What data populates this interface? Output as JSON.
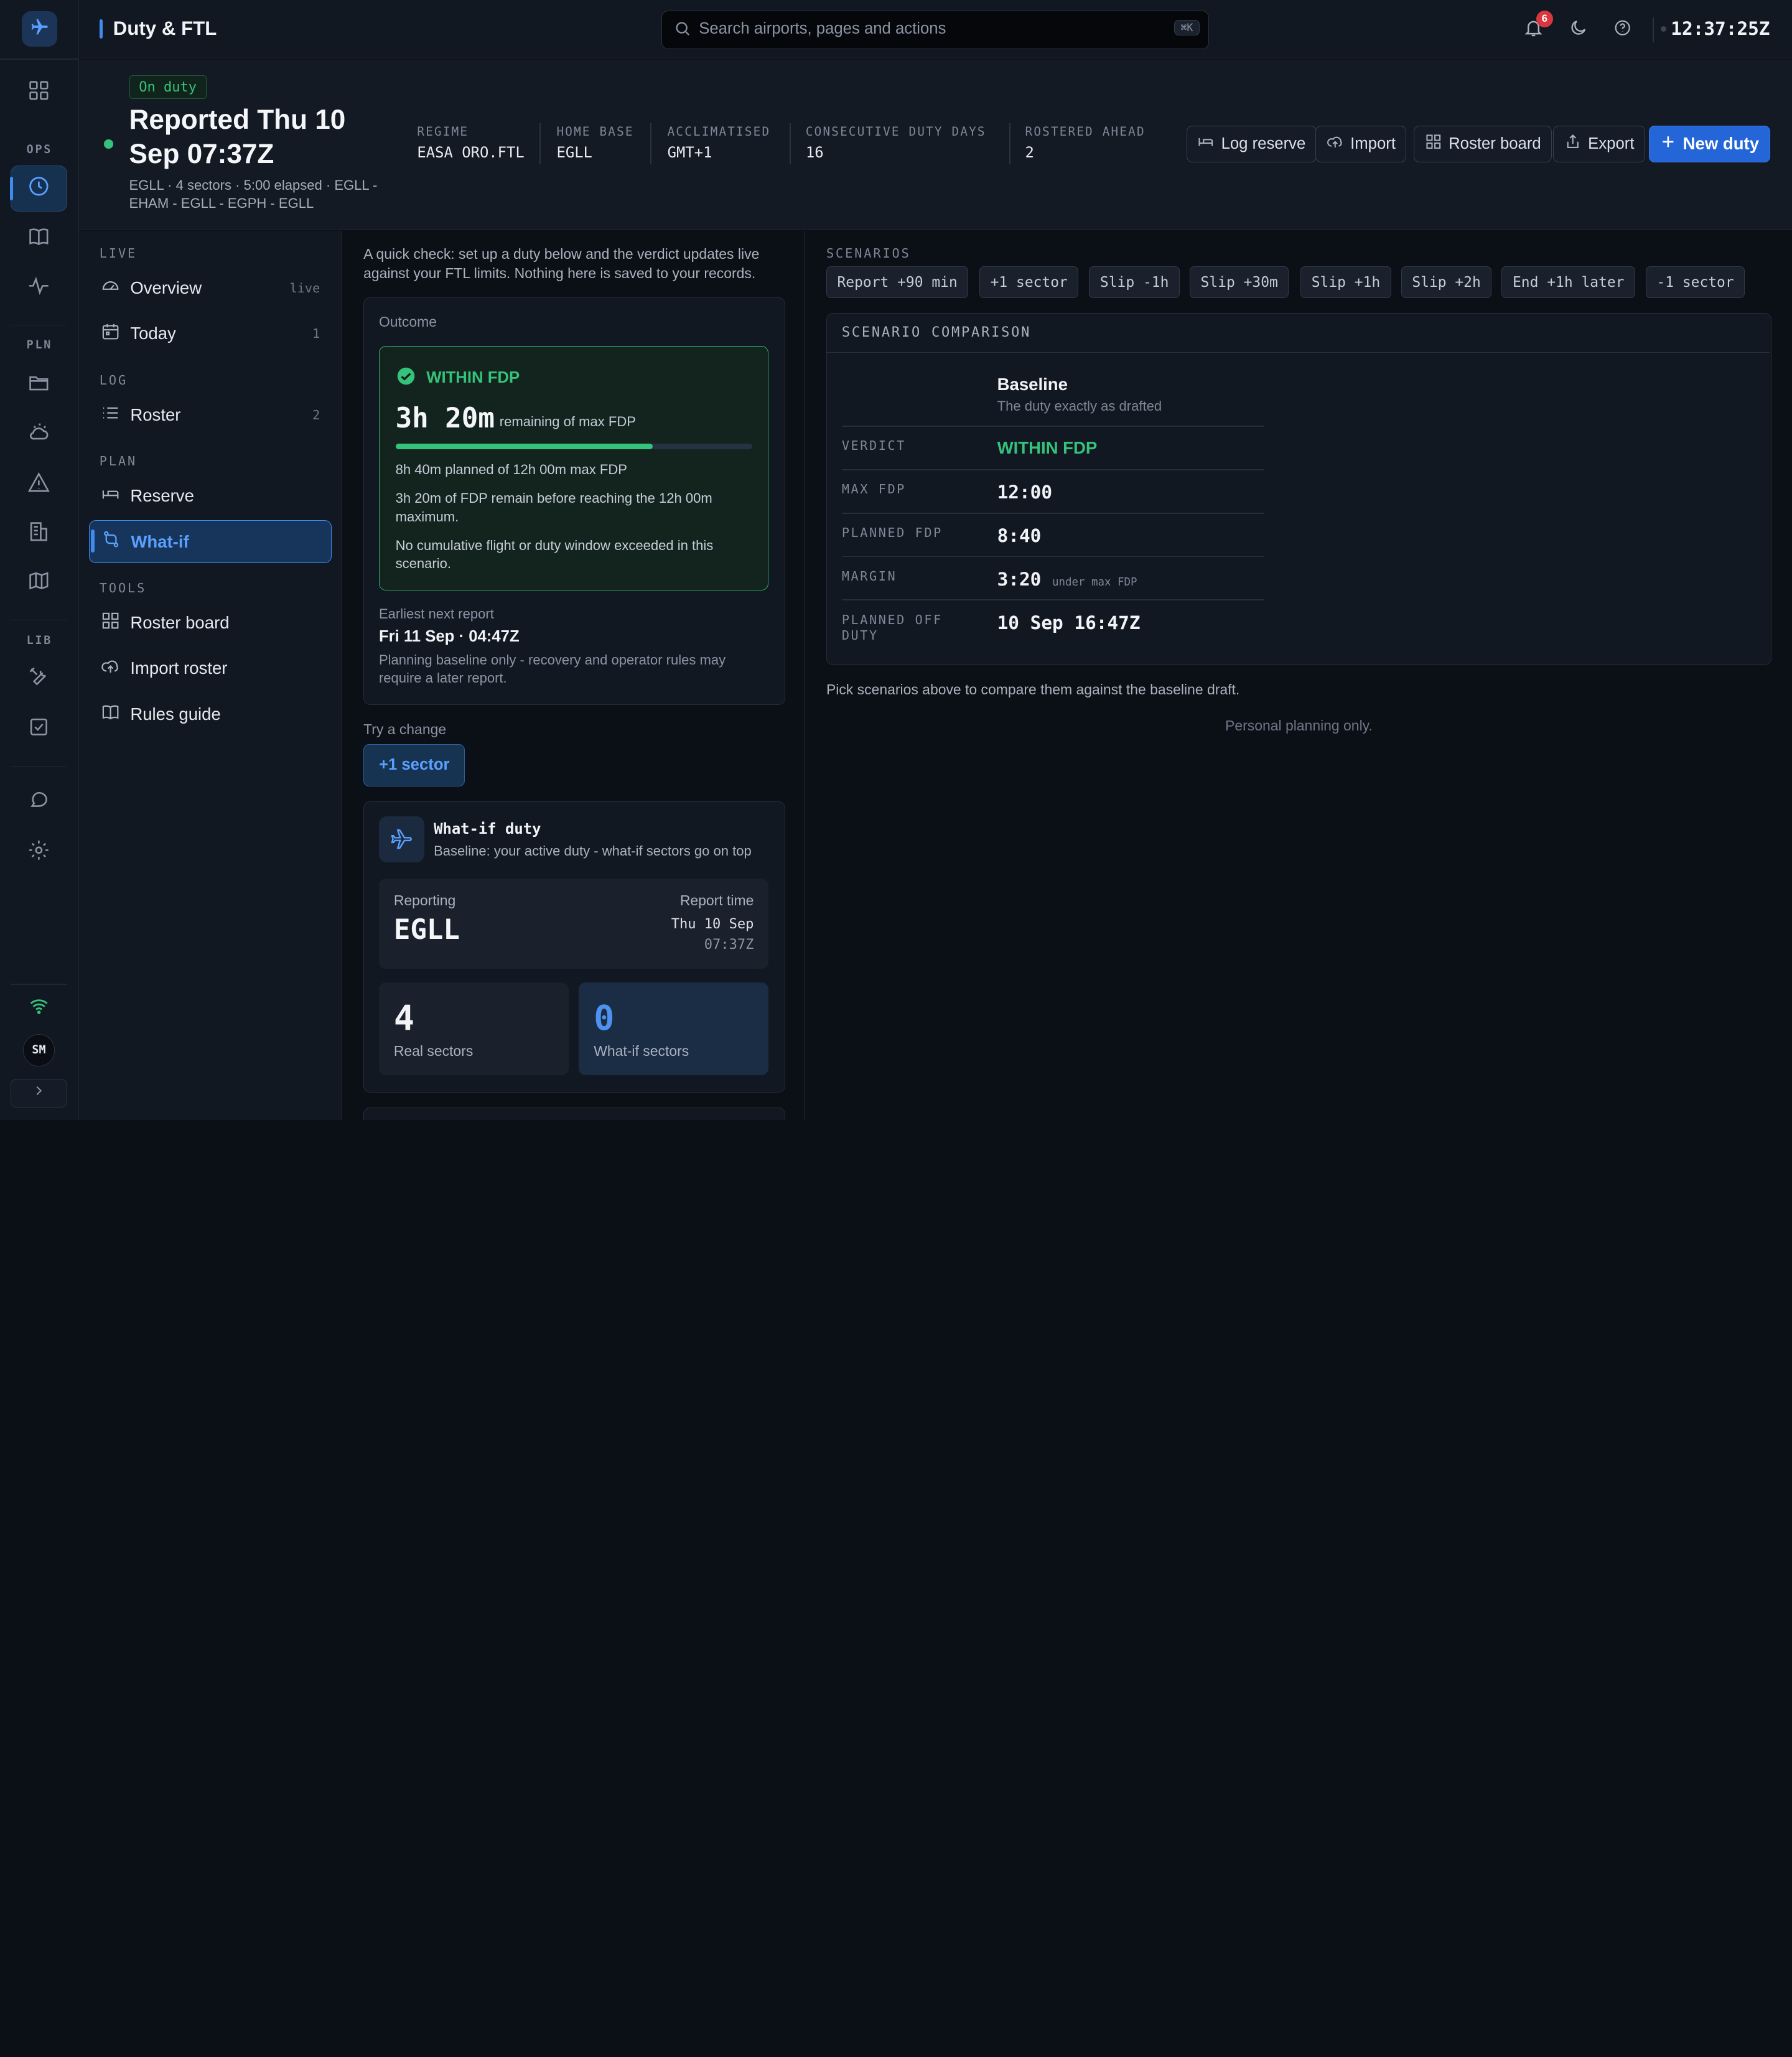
{
  "app": {
    "title": "Duty & FTL"
  },
  "rail": {
    "sections": [
      "OPS",
      "PLN",
      "LIB"
    ],
    "user_initials": "SM",
    "icons": [
      "plane-icon",
      "grid-icon",
      "clock-icon",
      "book-icon",
      "pulse-icon",
      "folder-icon",
      "cloud-sun-icon",
      "warning-icon",
      "building-icon",
      "map-icon",
      "tools-icon",
      "checkbox-icon",
      "chat-icon",
      "gear-icon",
      "wifi-icon",
      "chevron-right-icon"
    ]
  },
  "topbar": {
    "search_placeholder": "Search airports, pages and actions",
    "search_shortcut": "⌘K",
    "notification_count": "6",
    "clock": "12:37:25Z"
  },
  "header": {
    "status": "On duty",
    "headline": "Reported Thu 10 Sep 07:37Z",
    "subline": "EGLL · 4 sectors · 5:00 elapsed · EGLL - EHAM - EGLL - EGPH - EGLL",
    "stats": [
      {
        "label": "REGIME",
        "value": "EASA ORO.FTL"
      },
      {
        "label": "HOME BASE",
        "value": "EGLL"
      },
      {
        "label": "ACCLIMATISED",
        "value": "GMT+1"
      },
      {
        "label": "CONSECUTIVE DUTY DAYS",
        "value": "16"
      },
      {
        "label": "ROSTERED AHEAD",
        "value": "2"
      }
    ],
    "buttons": {
      "log_reserve": "Log reserve",
      "import": "Import",
      "roster_board": "Roster board",
      "export": "Export",
      "new_duty": "New duty"
    }
  },
  "sidebar": {
    "sections": [
      {
        "label": "LIVE",
        "items": [
          {
            "label": "Overview",
            "meta": "live"
          },
          {
            "label": "Today",
            "meta": "1"
          }
        ]
      },
      {
        "label": "LOG",
        "items": [
          {
            "label": "Roster",
            "meta": "2"
          }
        ]
      },
      {
        "label": "PLAN",
        "items": [
          {
            "label": "Reserve",
            "meta": ""
          },
          {
            "label": "What-if",
            "meta": ""
          }
        ]
      },
      {
        "label": "TOOLS",
        "items": [
          {
            "label": "Roster board",
            "meta": ""
          },
          {
            "label": "Import roster",
            "meta": ""
          },
          {
            "label": "Rules guide",
            "meta": ""
          }
        ]
      }
    ],
    "active_item": "What-if"
  },
  "whatif": {
    "intro": "A quick check: set up a duty below and the verdict updates live against your FTL limits. Nothing here is saved to your records.",
    "outcome": {
      "label": "Outcome",
      "verdict": "WITHIN FDP",
      "remaining": "3h 20m",
      "remaining_suffix": "remaining of max FDP",
      "progress_fraction": 0.722,
      "planned_line": "8h 40m planned of 12h 00m max FDP",
      "detail_1": "3h 20m of FDP remain before reaching the 12h 00m maximum.",
      "detail_2": "No cumulative flight or duty window exceeded in this scenario.",
      "next_report_label": "Earliest next report",
      "next_report_value": "Fri 11 Sep · 04:47Z",
      "next_report_note": "Planning baseline only - recovery and operator rules may require a later report."
    },
    "try_label": "Try a change",
    "try_button": "+1 sector",
    "duty_card": {
      "title": "What-if duty",
      "subtitle": "Baseline: your active duty - what-if sectors go on top",
      "reporting_label": "Reporting",
      "reporting_value": "EGLL",
      "report_time_label": "Report time",
      "report_time_date": "Thu 10 Sep",
      "report_time_time": "07:37Z",
      "real_sectors": "4",
      "real_sectors_label": "Real sectors",
      "whatif_sectors": "0",
      "whatif_sectors_label": "What-if sectors"
    }
  },
  "scenarios": {
    "label": "SCENARIOS",
    "chips": [
      "Report +90 min",
      "+1 sector",
      "Slip -1h",
      "Slip +30m",
      "Slip +1h",
      "Slip +2h",
      "End +1h later",
      "-1 sector"
    ],
    "comparison": {
      "title": "SCENARIO COMPARISON",
      "baseline_title": "Baseline",
      "baseline_sub": "The duty exactly as drafted",
      "rows": [
        {
          "label": "VERDICT",
          "value": "WITHIN FDP",
          "note": ""
        },
        {
          "label": "MAX FDP",
          "value": "12:00",
          "note": ""
        },
        {
          "label": "PLANNED FDP",
          "value": "8:40",
          "note": ""
        },
        {
          "label": "MARGIN",
          "value": "3:20",
          "note": "under max FDP"
        },
        {
          "label": "PLANNED OFF DUTY",
          "value": "10 Sep 16:47Z",
          "note": ""
        }
      ]
    },
    "hint": "Pick scenarios above to compare them against the baseline draft.",
    "footnote": "Personal planning only."
  },
  "colors": {
    "accent": "#3f8bf0",
    "success": "#35c27a",
    "alert": "#d8373f",
    "background": "#0b0f16"
  }
}
